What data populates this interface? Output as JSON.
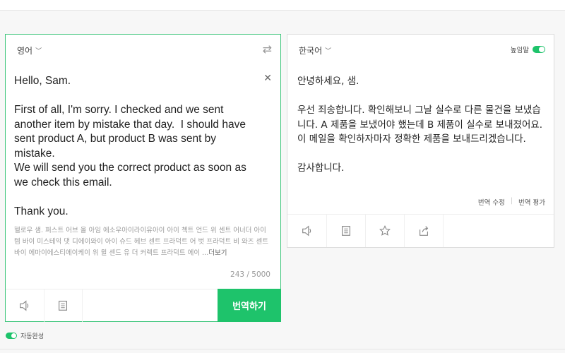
{
  "source": {
    "language": "영어",
    "text": "Hello, Sam.\n\nFirst of all, I'm sorry. I checked and we sent another item by mistake that day.  I should have sent product A, but product B was sent by mistake.\nWe will send you the correct product as soon as we check this email.\n\nThank you.",
    "pronunciation": "헬로우 샘. 퍼스트 어브 올 아임 에소우아이라이유아이 아이 첵트 언드 위 센트 어너더 아이템 바이 미스테익 댓 디에이와이 아이 슈드 헤브 센트 프라덕트 어 벗 프라덕트 비 와즈 센트 바이 에마이에스티에이케이 위 윌 센드 유 더 커렉트 프라덕트 에이 ...",
    "more_label": "더보기",
    "char_count": "243 / 5000",
    "translate_label": "번역하기"
  },
  "target": {
    "language": "한국어",
    "honorific_label": "높임말",
    "honorific_on": true,
    "text": "안녕하세요, 샘.\n\n우선 죄송합니다. 확인해보니 그날 실수로 다른 물건을 보냈습니다. A 제품을 보냈어야 했는데 B 제품이 실수로 보내졌어요.\n이 메일을 확인하자마자 정확한 제품을 보내드리겠습니다.\n\n감사합니다.",
    "edit_label": "번역 수정",
    "rate_label": "번역 평가"
  },
  "footer": {
    "autocomplete_label": "자동완성",
    "autocomplete_on": true
  },
  "colors": {
    "accent": "#1ec36b"
  }
}
